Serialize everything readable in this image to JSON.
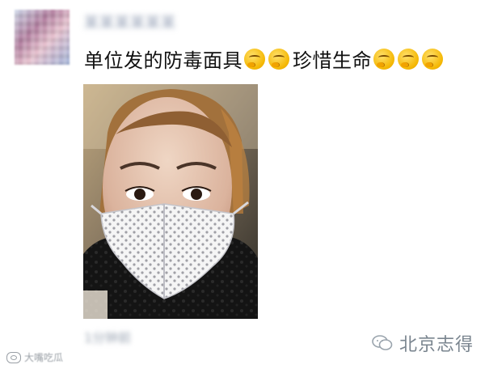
{
  "post": {
    "username": "某某某某某某",
    "caption_part1": "单位发的防毒面具",
    "caption_part2": "珍惜生命",
    "emoji_name": "thinking-face",
    "timestamp": "1分钟前",
    "photo_alt": "自拍照片"
  },
  "watermarks": {
    "left_text": "大嘴吃瓜",
    "right_text": "北京志得"
  },
  "colors": {
    "caption": "#111111",
    "username_blur": "#8f9bb2",
    "watermark": "#7a858f"
  }
}
